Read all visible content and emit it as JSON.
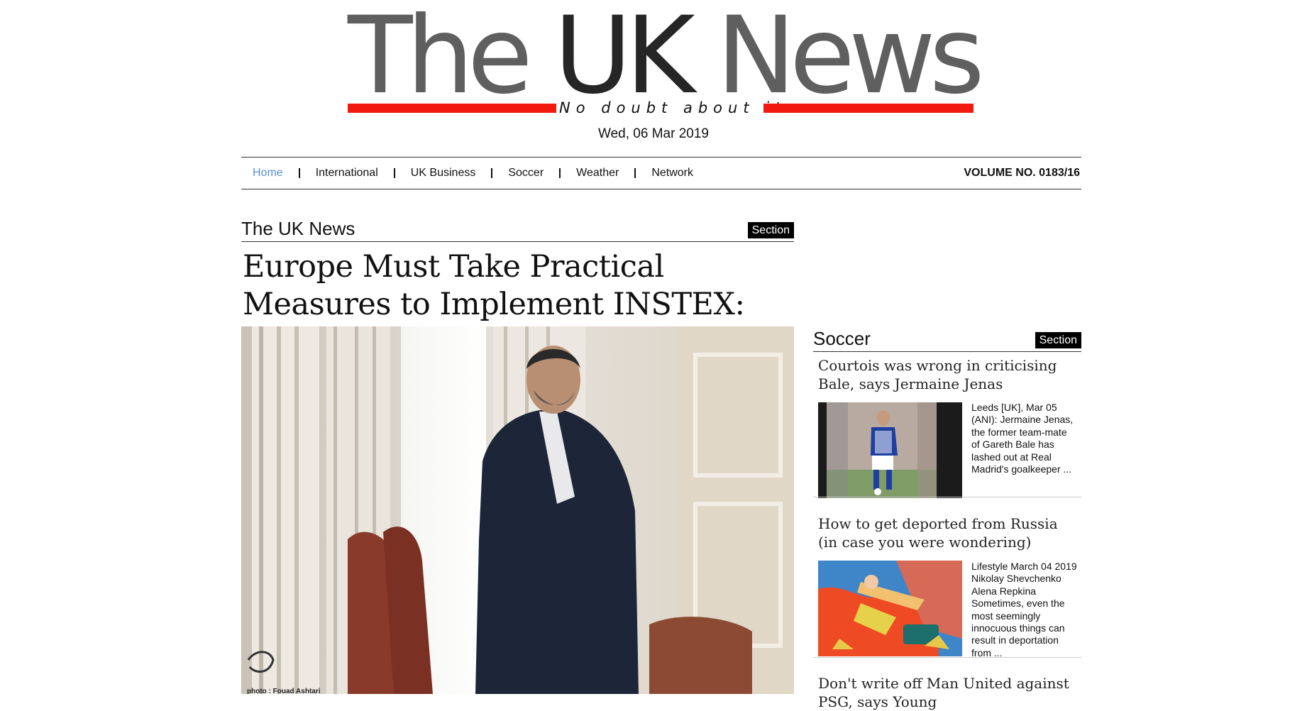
{
  "masthead": {
    "logo_text": "The UK News",
    "tagline": "No doubt about it",
    "date": "Wed, 06 Mar 2019"
  },
  "nav": {
    "items": [
      {
        "label": "Home",
        "active": true
      },
      {
        "label": "International"
      },
      {
        "label": "UK Business"
      },
      {
        "label": "Soccer"
      },
      {
        "label": "Weather"
      },
      {
        "label": "Network"
      }
    ],
    "volume": "VOLUME NO. 0183/16"
  },
  "main": {
    "section_title": "The UK News",
    "section_badge": "Section",
    "headline": "Europe Must Take Practical Measures to Implement INSTEX: Iran",
    "image_credit": "photo : Fouad Ashtari"
  },
  "sidebar": {
    "section_title": "Soccer",
    "section_badge": "Section",
    "stories": [
      {
        "title": "Courtois was wrong in criticising Bale, says Jermaine Jenas",
        "excerpt": "Leeds [UK], Mar 05 (ANI): Jermaine Jenas, the former team-mate of Gareth Bale has lashed out at Real Madrid's goalkeeper ..."
      },
      {
        "title": "How to get deported from Russia (in case you were wondering)",
        "excerpt": "Lifestyle March 04 2019 Nikolay Shevchenko Alena Repkina Sometimes, even the most seemingly innocuous things can result in deportation from ..."
      },
      {
        "title": "Don't write off Man United against PSG, says Young"
      }
    ]
  },
  "colors": {
    "accent_red": "#f21a10",
    "nav_active": "#5b8fd3",
    "badge_bg": "#000000"
  }
}
